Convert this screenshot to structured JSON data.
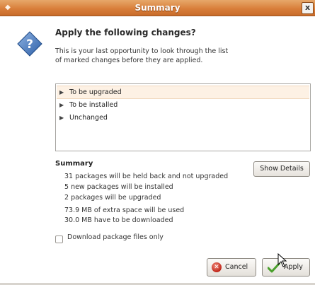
{
  "window": {
    "title": "Summary",
    "menu_glyph": "◆",
    "close_glyph": "x"
  },
  "icons": {
    "dialog": "question-diamond-icon",
    "cancel": "cancel-icon",
    "apply": "checkmark-icon"
  },
  "dialog": {
    "heading": "Apply the following changes?",
    "intro": "This is your last opportunity to look through the list of marked changes before they are applied."
  },
  "changes_tree": {
    "items": [
      {
        "label": "To be upgraded",
        "selected": true
      },
      {
        "label": "To be installed",
        "selected": false
      },
      {
        "label": "Unchanged",
        "selected": false
      }
    ]
  },
  "summary": {
    "title": "Summary",
    "lines": [
      "31 packages will be held back and not upgraded",
      "5 new packages will be installed",
      "2 packages will be upgraded",
      "73.9 MB of extra space will be used",
      "30.0 MB have to be downloaded"
    ],
    "show_details_label": "Show Details"
  },
  "options": {
    "download_only_label": "Download package files only",
    "download_only_checked": false
  },
  "buttons": {
    "cancel_label": "Cancel",
    "apply_label": "Apply"
  },
  "colors": {
    "titlebar": "#d97f3b",
    "selection": "#fdf1e4",
    "icon_blue": "#3b6fb6"
  }
}
